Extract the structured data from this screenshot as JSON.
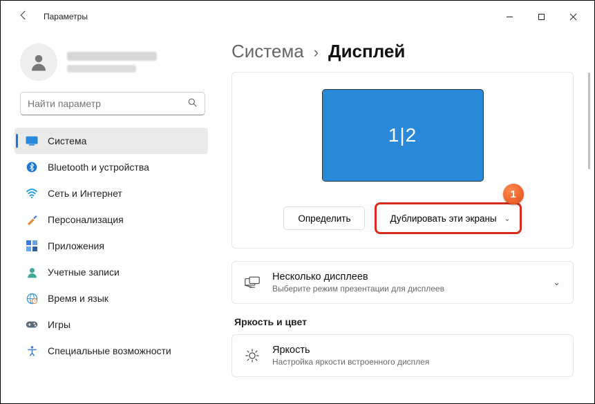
{
  "window": {
    "app_title": "Параметры"
  },
  "user": {
    "name_redacted": true
  },
  "search": {
    "placeholder": "Найти параметр"
  },
  "nav": {
    "items": [
      {
        "label": "Система"
      },
      {
        "label": "Bluetooth и устройства"
      },
      {
        "label": "Сеть и Интернет"
      },
      {
        "label": "Персонализация"
      },
      {
        "label": "Приложения"
      },
      {
        "label": "Учетные записи"
      },
      {
        "label": "Время и язык"
      },
      {
        "label": "Игры"
      },
      {
        "label": "Специальные возможности"
      }
    ]
  },
  "breadcrumb": {
    "parent": "Система",
    "current": "Дисплей"
  },
  "display": {
    "monitor_label": "1|2",
    "identify_button": "Определить",
    "mode_dropdown": "Дублировать эти экраны",
    "badge": "1"
  },
  "multi_displays": {
    "title": "Несколько дисплеев",
    "subtitle": "Выберите режим презентации для дисплеев"
  },
  "brightness_section": {
    "heading": "Яркость и цвет",
    "brightness_title": "Яркость",
    "brightness_subtitle": "Настройка яркости встроенного дисплея"
  }
}
